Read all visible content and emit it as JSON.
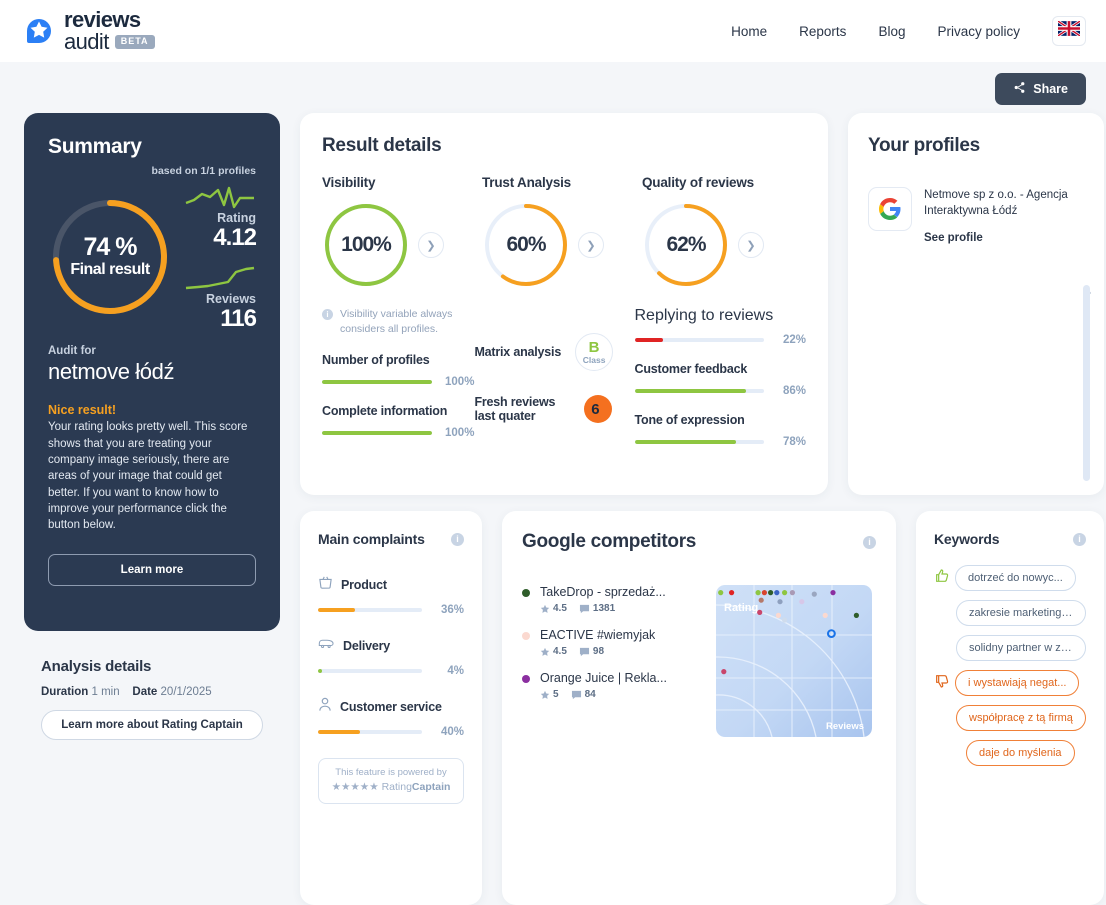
{
  "brand": {
    "line1": "reviews",
    "line2": "audit",
    "beta": "BETA",
    "logo_color": "#2b7ff5"
  },
  "nav": {
    "items": [
      {
        "label": "Home"
      },
      {
        "label": "Reports"
      },
      {
        "label": "Blog"
      },
      {
        "label": "Privacy policy"
      }
    ],
    "language_icon": "uk-flag-icon"
  },
  "share": {
    "label": "Share",
    "icon": "share-icon"
  },
  "summary": {
    "title": "Summary",
    "based_on": "based on 1/1 profiles",
    "final_percent": "74 %",
    "final_value": 74,
    "final_label": "Final result",
    "ring_color": "#f6a020",
    "rating_label": "Rating",
    "rating_value": "4.12",
    "reviews_label": "Reviews",
    "reviews_value": "116",
    "audit_for_label": "Audit for",
    "company": "netmove łódź",
    "verdict": "Nice result!",
    "blurb": "Your rating looks pretty well. This score shows that you are treating your company image seriously, there are areas of your image that could get better. If you want to know how to improve your performance click the button below.",
    "learn_more": "Learn more"
  },
  "analysis": {
    "title": "Analysis details",
    "duration_label": "Duration",
    "duration_value": "1 min",
    "date_label": "Date",
    "date_value": "20/1/2025",
    "button": "Learn more about Rating Captain"
  },
  "results": {
    "title": "Result details",
    "rings": [
      {
        "title": "Visibility",
        "value": 100,
        "text": "100%",
        "color": "#8ec641"
      },
      {
        "title": "Trust Analysis",
        "value": 60,
        "text": "60%",
        "color": "#f6a020"
      },
      {
        "title": "Quality of reviews",
        "value": 62,
        "text": "62%",
        "color": "#f6a020"
      }
    ],
    "note": "Visibility variable always considers all profiles.",
    "visibility_metrics": [
      {
        "label": "Number of profiles",
        "value": 100,
        "text": "100%",
        "color": "#8ec641"
      },
      {
        "label": "Complete information",
        "value": 100,
        "text": "100%",
        "color": "#8ec641"
      }
    ],
    "matrix_label": "Matrix analysis",
    "matrix_class": "B",
    "matrix_class_sub": "Class",
    "fresh_label": "Fresh reviews last quater",
    "fresh_value": "6",
    "quality_metrics": [
      {
        "label": "Replying to reviews",
        "value": 22,
        "text": "22%",
        "color": "#e02424"
      },
      {
        "label": "Customer feedback",
        "value": 86,
        "text": "86%",
        "color": "#8ec641"
      },
      {
        "label": "Tone of expression",
        "value": 78,
        "text": "78%",
        "color": "#8ec641"
      }
    ]
  },
  "profiles": {
    "title": "Your profiles",
    "items": [
      {
        "icon": "google-icon",
        "name": "Netmove sp z o.o. - Agencja Interaktywna Łódź",
        "link": "See profile"
      }
    ]
  },
  "complaints": {
    "title": "Main complaints",
    "items": [
      {
        "icon": "basket-icon",
        "label": "Product",
        "value": 36,
        "text": "36%",
        "color": "#f6a020"
      },
      {
        "icon": "van-icon",
        "label": "Delivery",
        "value": 4,
        "text": "4%",
        "color": "#8ec641"
      },
      {
        "icon": "person-icon",
        "label": "Customer service",
        "value": 40,
        "text": "40%",
        "color": "#f6a020"
      }
    ],
    "powered_line1": "This feature is powered by",
    "powered_stars": "★★★★★",
    "powered_brand_light": "Rating",
    "powered_brand_bold": "Captain"
  },
  "competitors": {
    "title": "Google competitors",
    "items": [
      {
        "name": "TakeDrop - sprzedaż...",
        "rating": "4.5",
        "reviews": "1381",
        "color": "#2f5d2a"
      },
      {
        "name": "EACTIVE #wiemyjak",
        "rating": "4.5",
        "reviews": "98",
        "color": "#fbd9d0"
      },
      {
        "name": "Orange Juice | Rekla...",
        "rating": "5",
        "reviews": "84",
        "color": "#8b2fa0"
      }
    ]
  },
  "chart_data": {
    "type": "scatter",
    "title": "",
    "xlabel": "Reviews",
    "ylabel": "Rating",
    "grid": true,
    "xlim": [
      0,
      100
    ],
    "ylim": [
      0,
      100
    ],
    "points": [
      {
        "x": 3,
        "y": 95,
        "color": "#8ec641"
      },
      {
        "x": 10,
        "y": 95,
        "color": "#e02424"
      },
      {
        "x": 27,
        "y": 95,
        "color": "#8ec641"
      },
      {
        "x": 31,
        "y": 95,
        "color": "#d8452f"
      },
      {
        "x": 35,
        "y": 95,
        "color": "#2f5d2a"
      },
      {
        "x": 39,
        "y": 95,
        "color": "#3b64c4"
      },
      {
        "x": 44,
        "y": 95,
        "color": "#8ec641"
      },
      {
        "x": 49,
        "y": 95,
        "color": "#a99ab5"
      },
      {
        "x": 63,
        "y": 94,
        "color": "#9aa6c0"
      },
      {
        "x": 75,
        "y": 95,
        "color": "#8b2fa0"
      },
      {
        "x": 29,
        "y": 90,
        "color": "#b5796a"
      },
      {
        "x": 41,
        "y": 89,
        "color": "#8ea0bf"
      },
      {
        "x": 55,
        "y": 89,
        "color": "#d7c7e8"
      },
      {
        "x": 28,
        "y": 82,
        "color": "#c9456b"
      },
      {
        "x": 40,
        "y": 80,
        "color": "#fbd9d0"
      },
      {
        "x": 44,
        "y": 77,
        "color": "#cfdced"
      },
      {
        "x": 70,
        "y": 80,
        "color": "#fbd9d0"
      },
      {
        "x": 90,
        "y": 80,
        "color": "#2f5d2a"
      },
      {
        "x": 5,
        "y": 43,
        "color": "#c9456b"
      },
      {
        "x": 74,
        "y": 68,
        "color": "#1a73e8"
      }
    ]
  },
  "keywords": {
    "title": "Keywords",
    "items": [
      {
        "sentiment": "positive",
        "icon": "thumbs-up-icon",
        "text": "dotrzeć do nowyc..."
      },
      {
        "sentiment": "positive",
        "icon": null,
        "text": "zakresie marketingu in..."
      },
      {
        "sentiment": "positive",
        "icon": null,
        "text": "solidny partner w zakr..."
      },
      {
        "sentiment": "negative",
        "icon": "thumbs-down-icon",
        "text": "i wystawiają negat..."
      },
      {
        "sentiment": "negative",
        "icon": null,
        "text": "współpracę z tą firmą"
      },
      {
        "sentiment": "negative",
        "icon": null,
        "text": "daje do myślenia"
      }
    ]
  }
}
